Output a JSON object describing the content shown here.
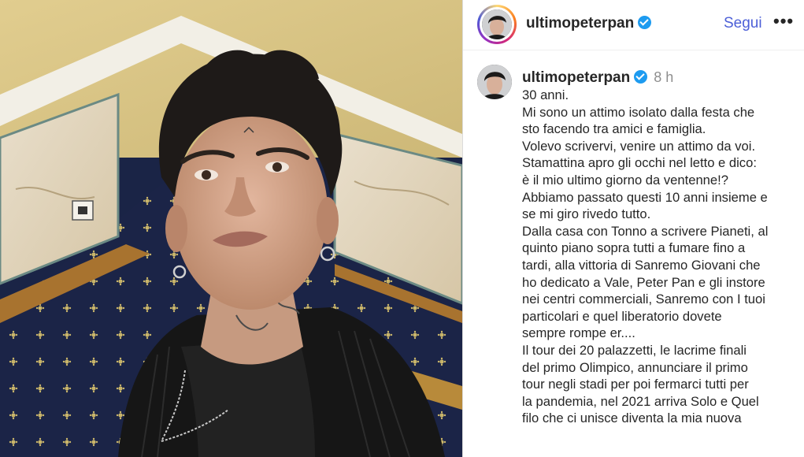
{
  "post": {
    "username": "ultimopeterpan",
    "follow_label": "Segui",
    "more_label": "•••",
    "timestamp": "8 h",
    "caption_lines": [
      "30 anni.",
      "Mi sono un attimo isolato dalla festa che",
      "sto facendo tra amici e famiglia.",
      "Volevo scrivervi, venire un attimo da voi.",
      "Stamattina apro gli occhi nel letto e dico:",
      "è il mio ultimo giorno da ventenne!?",
      "Abbiamo passato questi 10 anni insieme e",
      "se mi giro rivedo tutto.",
      "Dalla casa con Tonno a scrivere Pianeti, al",
      "quinto piano sopra tutti a fumare fino a",
      "tardi, alla vittoria di Sanremo Giovani che",
      "ho dedicato a Vale, Peter Pan e gli instore",
      "nei centri commerciali, Sanremo con I tuoi",
      "particolari e quel liberatorio dovete",
      "sempre rompe er....",
      "Il tour dei 20 palazzetti, le lacrime finali",
      "del primo Olimpico, annunciare il primo",
      "tour negli stadi per poi fermarci tutti per",
      "la pandemia, nel 2021 arriva Solo e Quel",
      "filo che ci unisce diventa la mia nuova"
    ]
  },
  "colors": {
    "follow": "#4c5fd7",
    "verified": "#1d9bf0",
    "timestamp": "#8e8e8e",
    "carpet": "#1a2446",
    "wall": "#d9c78c"
  },
  "icons": {
    "verified": "verified-badge-icon",
    "more": "more-options-icon"
  }
}
